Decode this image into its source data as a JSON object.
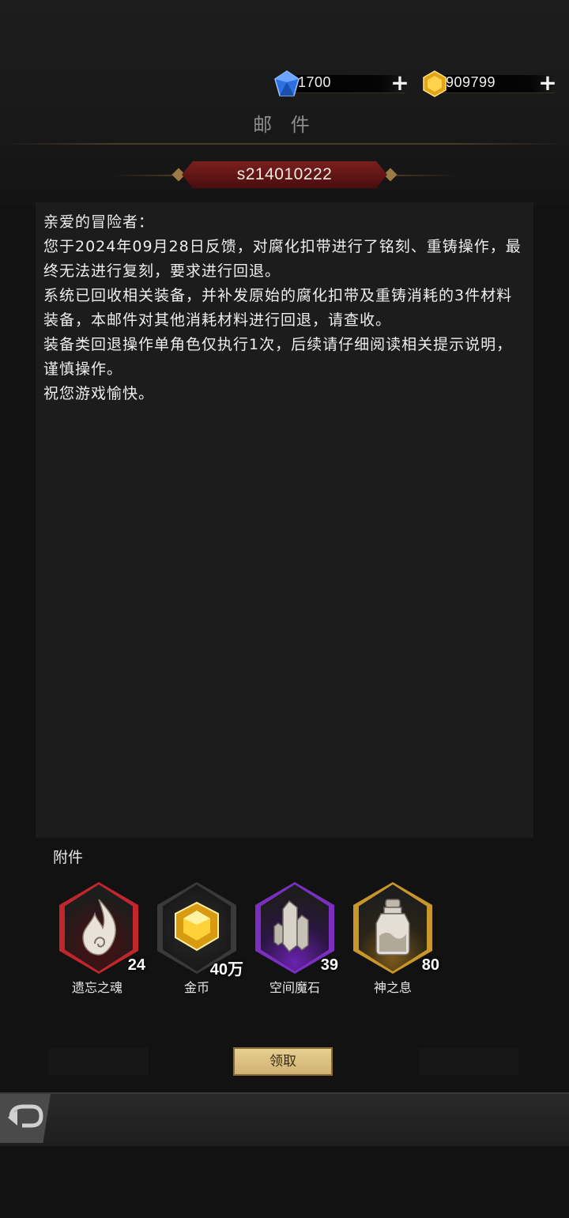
{
  "currencies": {
    "diamond": {
      "value": "1700",
      "icon": "blue-diamond-icon",
      "color": "#3a78e8"
    },
    "gold": {
      "value": "909799",
      "icon": "gold-gem-icon",
      "color": "#e8b020"
    }
  },
  "page": {
    "title": "邮 件"
  },
  "mail": {
    "sender": "s214010222",
    "body": "亲爱的冒险者：\n您于2024年09月28日反馈，对腐化扣带进行了铭刻、重铸操作，最终无法进行复刻，要求进行回退。\n系统已回收相关装备，并补发原始的腐化扣带及重铸消耗的3件材料装备，本邮件对其他消耗材料进行回退，请查收。\n装备类回退操作单角色仅执行1次，后续请仔细阅读相关提示说明，谨慎操作。\n祝您游戏愉快。"
  },
  "attachments": {
    "title": "附件",
    "items": [
      {
        "name": "遗忘之魂",
        "qty": "24",
        "icon": "soul-flame-icon",
        "rarity_color": "#c0262b"
      },
      {
        "name": "金币",
        "qty": "40万",
        "icon": "gold-coin-icon",
        "rarity_color": "#4a4a4a"
      },
      {
        "name": "空间魔石",
        "qty": "39",
        "icon": "crystal-icon",
        "rarity_color": "#7b2fc0"
      },
      {
        "name": "神之息",
        "qty": "80",
        "icon": "bottle-icon",
        "rarity_color": "#c8962a"
      }
    ]
  },
  "actions": {
    "claim": "领取"
  }
}
